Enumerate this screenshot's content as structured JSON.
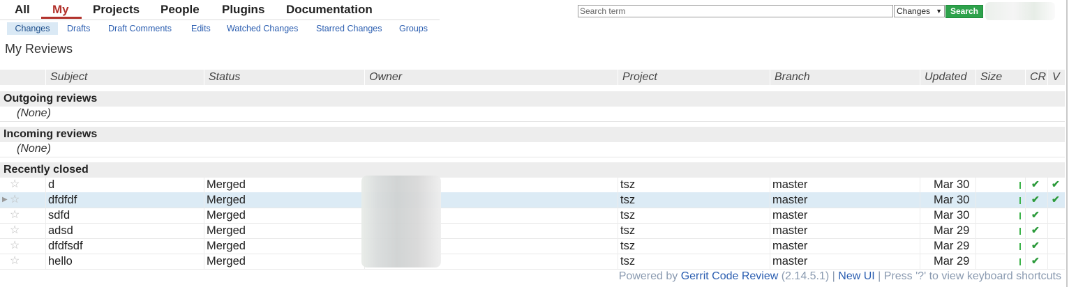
{
  "top_menu": [
    {
      "label": "All"
    },
    {
      "label": "My",
      "active": true
    },
    {
      "label": "Projects"
    },
    {
      "label": "People"
    },
    {
      "label": "Plugins"
    },
    {
      "label": "Documentation"
    }
  ],
  "sub_menu": [
    {
      "label": "Changes",
      "active": true
    },
    {
      "label": "Drafts"
    },
    {
      "label": "Draft Comments"
    },
    {
      "label": "Edits"
    },
    {
      "label": "Watched Changes"
    },
    {
      "label": "Starred Changes"
    },
    {
      "label": "Groups"
    }
  ],
  "search": {
    "placeholder": "Search term",
    "scope_selected": "Changes",
    "button_label": "Search"
  },
  "page_title": "My Reviews",
  "table": {
    "headers": {
      "subject": "Subject",
      "status": "Status",
      "owner": "Owner",
      "project": "Project",
      "branch": "Branch",
      "updated": "Updated",
      "size": "Size",
      "cr": "CR",
      "v": "V"
    },
    "sections": [
      {
        "title": "Outgoing reviews",
        "empty_text": "(None)"
      },
      {
        "title": "Incoming reviews",
        "empty_text": "(None)"
      },
      {
        "title": "Recently closed"
      }
    ],
    "rows": [
      {
        "subject": "d",
        "status": "Merged",
        "project": "tsz",
        "branch": "master",
        "updated": "Mar 30",
        "cr": "✔",
        "v": "✔"
      },
      {
        "subject": "dfdfdf",
        "status": "Merged",
        "project": "tsz",
        "branch": "master",
        "updated": "Mar 30",
        "cr": "✔",
        "v": "✔",
        "selected": true
      },
      {
        "subject": "sdfd",
        "status": "Merged",
        "project": "tsz",
        "branch": "master",
        "updated": "Mar 30",
        "cr": "✔",
        "v": ""
      },
      {
        "subject": "adsd",
        "status": "Merged",
        "project": "tsz",
        "branch": "master",
        "updated": "Mar 29",
        "cr": "✔",
        "v": ""
      },
      {
        "subject": "dfdfsdf",
        "status": "Merged",
        "project": "tsz",
        "branch": "master",
        "updated": "Mar 29",
        "cr": "✔",
        "v": ""
      },
      {
        "subject": "hello",
        "status": "Merged",
        "project": "tsz",
        "branch": "master",
        "updated": "Mar 29",
        "cr": "✔",
        "v": ""
      }
    ]
  },
  "footer": {
    "powered_by": "Powered by ",
    "product_link": "Gerrit Code Review",
    "version": " (2.14.5.1) | ",
    "new_ui_link": "New UI",
    "shortcuts_text": " | Press '?' to view keyboard shortcuts"
  },
  "colors": {
    "accent_red": "#b2322c",
    "link_blue": "#2a5db0",
    "search_green": "#2da24b",
    "check_green": "#2b9a3a",
    "selected_row": "#dcebf5"
  },
  "icons": {
    "star": "star-icon",
    "check": "check-icon",
    "pointer": "row-pointer-icon"
  }
}
